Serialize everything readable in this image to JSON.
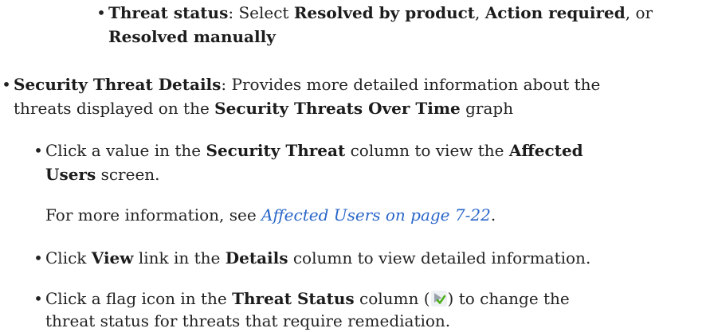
{
  "colors": {
    "text": "#222222",
    "link": "#2a67c9",
    "flag_icon_green": "#4caf1a",
    "flag_icon_gray": "#9aa3ad"
  },
  "threat_status_item": {
    "label": "Threat status",
    "sep1": ": Select ",
    "opt1": "Resolved by product",
    "sep2": ", ",
    "opt2": "Action required",
    "sep3": ", or",
    "opt3": "Resolved manually"
  },
  "security_threat_details": {
    "label": "Security Threat Details",
    "desc_a": ": Provides more detailed information about the",
    "desc_b1": "threats displayed on the ",
    "desc_b_bold": "Security Threats Over Time",
    "desc_b2": " graph"
  },
  "sub1": {
    "t1": "Click a value in the ",
    "b1": "Security Threat",
    "t2": " column to view the ",
    "b2": "Affected",
    "b3": "Users",
    "t3": " screen."
  },
  "more_info": {
    "prefix": "For more information, see ",
    "link": "Affected Users on page 7-22",
    "suffix": "."
  },
  "sub2": {
    "t1": "Click ",
    "b1": "View",
    "t2": " link in the ",
    "b2": "Details",
    "t3": " column to view detailed information."
  },
  "sub3": {
    "t1": "Click a flag icon in the ",
    "b1": "Threat Status",
    "t2": " column (",
    "icon": "flag-check-icon",
    "t3": ") to change the",
    "t4": "threat status for threats that require remediation."
  }
}
